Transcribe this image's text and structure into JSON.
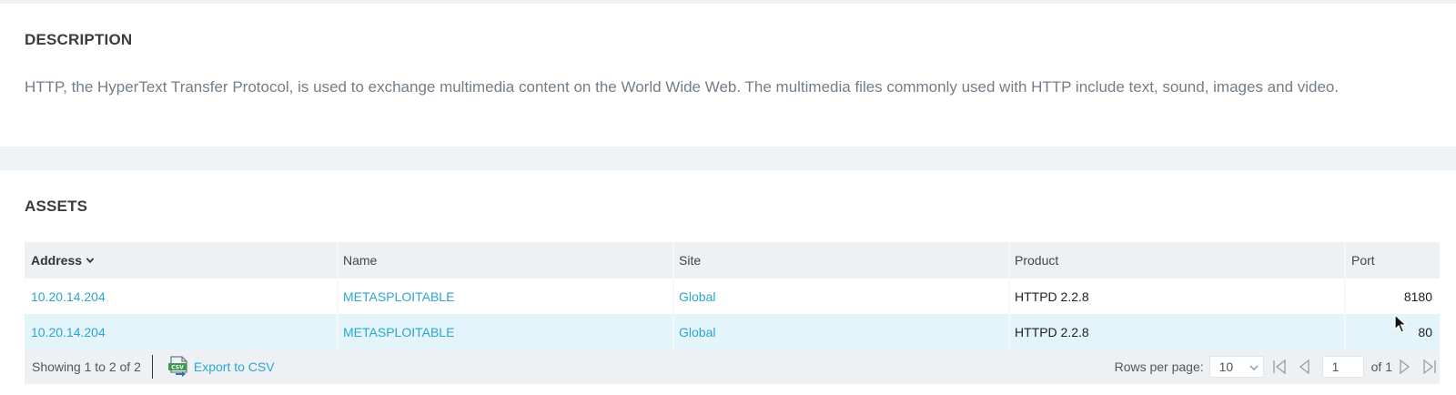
{
  "description": {
    "title": "DESCRIPTION",
    "text": "HTTP, the HyperText Transfer Protocol, is used to exchange multimedia content on the World Wide Web. The multimedia files commonly used with HTTP include text, sound, images and video."
  },
  "assets": {
    "title": "ASSETS",
    "columns": {
      "address": "Address",
      "name": "Name",
      "site": "Site",
      "product": "Product",
      "port": "Port"
    },
    "rows": [
      {
        "address": "10.20.14.204",
        "name": "METASPLOITABLE",
        "site": "Global",
        "product": "HTTPD 2.2.8",
        "port": "8180"
      },
      {
        "address": "10.20.14.204",
        "name": "METASPLOITABLE",
        "site": "Global",
        "product": "HTTPD 2.2.8",
        "port": "80"
      }
    ],
    "footer": {
      "showing": "Showing 1 to 2 of 2",
      "export_label": "Export to CSV",
      "rows_per_page_label": "Rows per page:",
      "rows_per_page_value": "10",
      "page_value": "1",
      "of_pages": "of 1"
    },
    "sorted_column": "Address",
    "link_color": "#2ba6cf"
  }
}
